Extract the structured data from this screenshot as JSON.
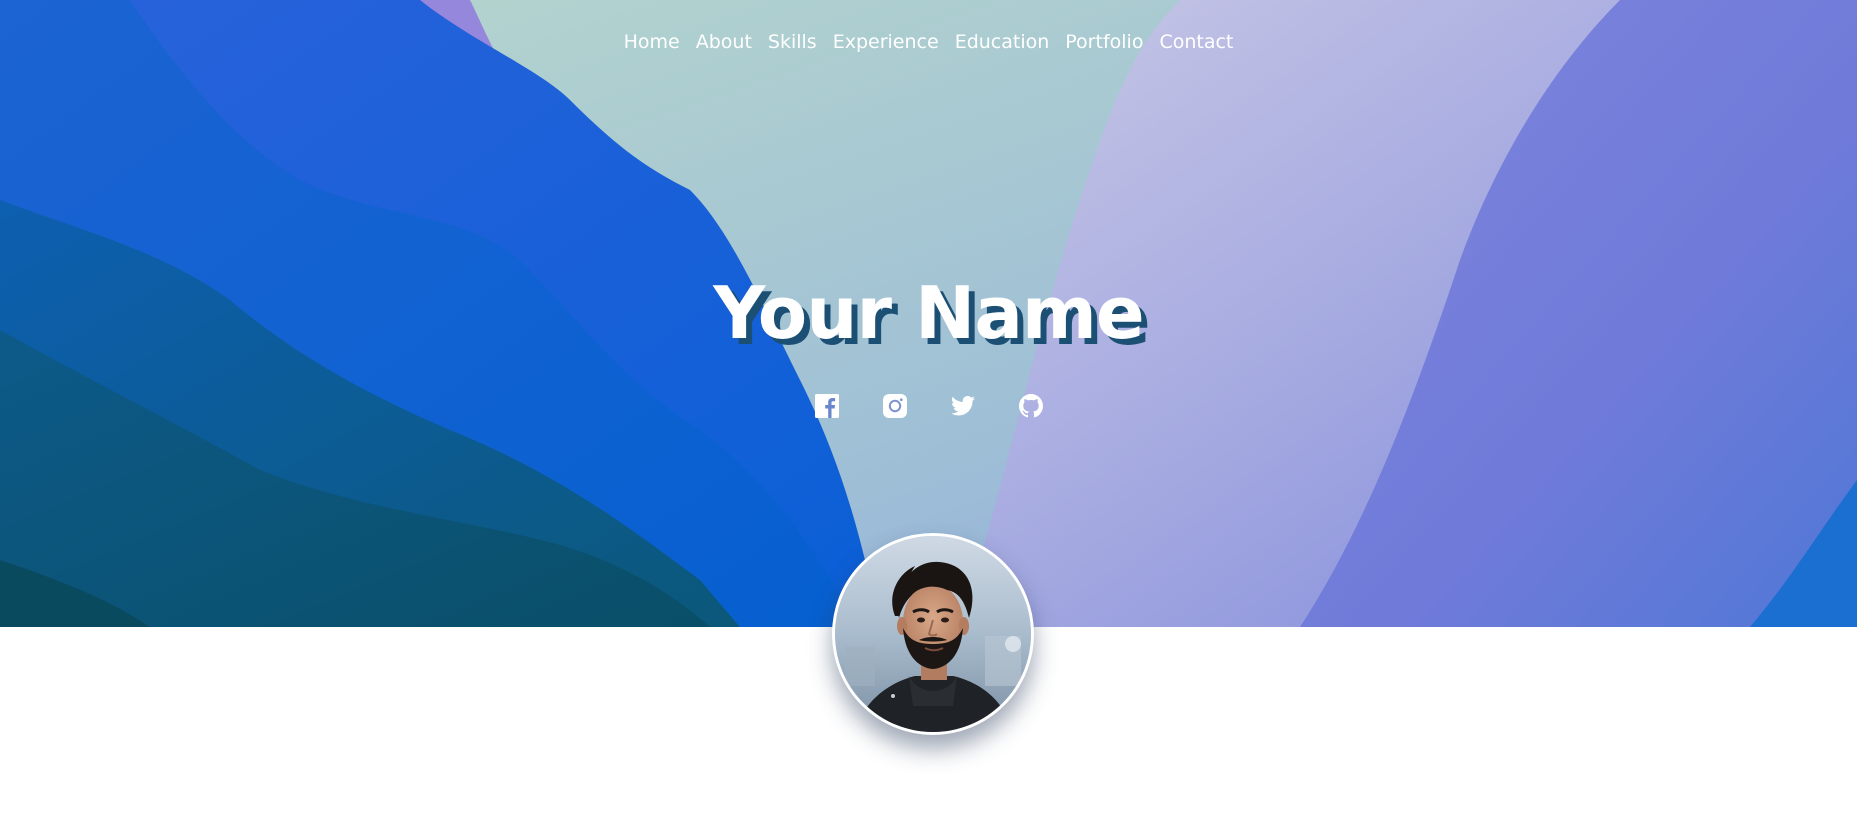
{
  "nav": {
    "items": [
      {
        "label": "Home"
      },
      {
        "label": "About"
      },
      {
        "label": "Skills"
      },
      {
        "label": "Experience"
      },
      {
        "label": "Education"
      },
      {
        "label": "Portfolio"
      },
      {
        "label": "Contact"
      }
    ]
  },
  "hero": {
    "title": "Your Name",
    "title_shadow_color": "#1c4f74"
  },
  "socials": [
    {
      "icon": "facebook-icon"
    },
    {
      "icon": "instagram-icon"
    },
    {
      "icon": "twitter-icon"
    },
    {
      "icon": "github-icon"
    }
  ],
  "colors": {
    "hero_blue": "#1f5fd8",
    "hero_teal": "#0f5a78",
    "hero_mint": "#a9ccc8",
    "hero_lavender": "#8f95dc",
    "text": "#ffffff"
  },
  "avatar": {
    "icon": "profile-photo"
  }
}
